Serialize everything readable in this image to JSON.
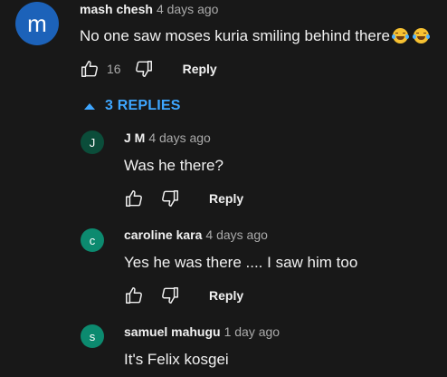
{
  "colors": {
    "background": "#181818",
    "link_blue": "#3ea6ff",
    "avatar_m": "#1c62b9",
    "avatar_jm": "#0b4d3a",
    "avatar_c": "#0c8a6f",
    "avatar_s": "#0c8a6f"
  },
  "top_comment": {
    "avatar_letter": "m",
    "author": "mash chesh",
    "time": "4 days ago",
    "text": "No one saw moses kuria smiling behind there",
    "emoji": [
      "face-with-tears-of-joy",
      "face-with-tears-of-joy"
    ],
    "likes": "16",
    "reply_label": "Reply"
  },
  "replies_toggle": {
    "icon": "caret-up-icon",
    "label": "3 REPLIES"
  },
  "replies": [
    {
      "avatar_letter": "J",
      "author": "J M",
      "time": "4 days ago",
      "text": "Was he there?",
      "reply_label": "Reply"
    },
    {
      "avatar_letter": "c",
      "author": "caroline kara",
      "time": "4 days ago",
      "text": "Yes he was there .... I saw him too",
      "reply_label": "Reply"
    },
    {
      "avatar_letter": "s",
      "author": "samuel mahugu",
      "time": "1 day ago",
      "text": "It's Felix kosgei"
    }
  ]
}
